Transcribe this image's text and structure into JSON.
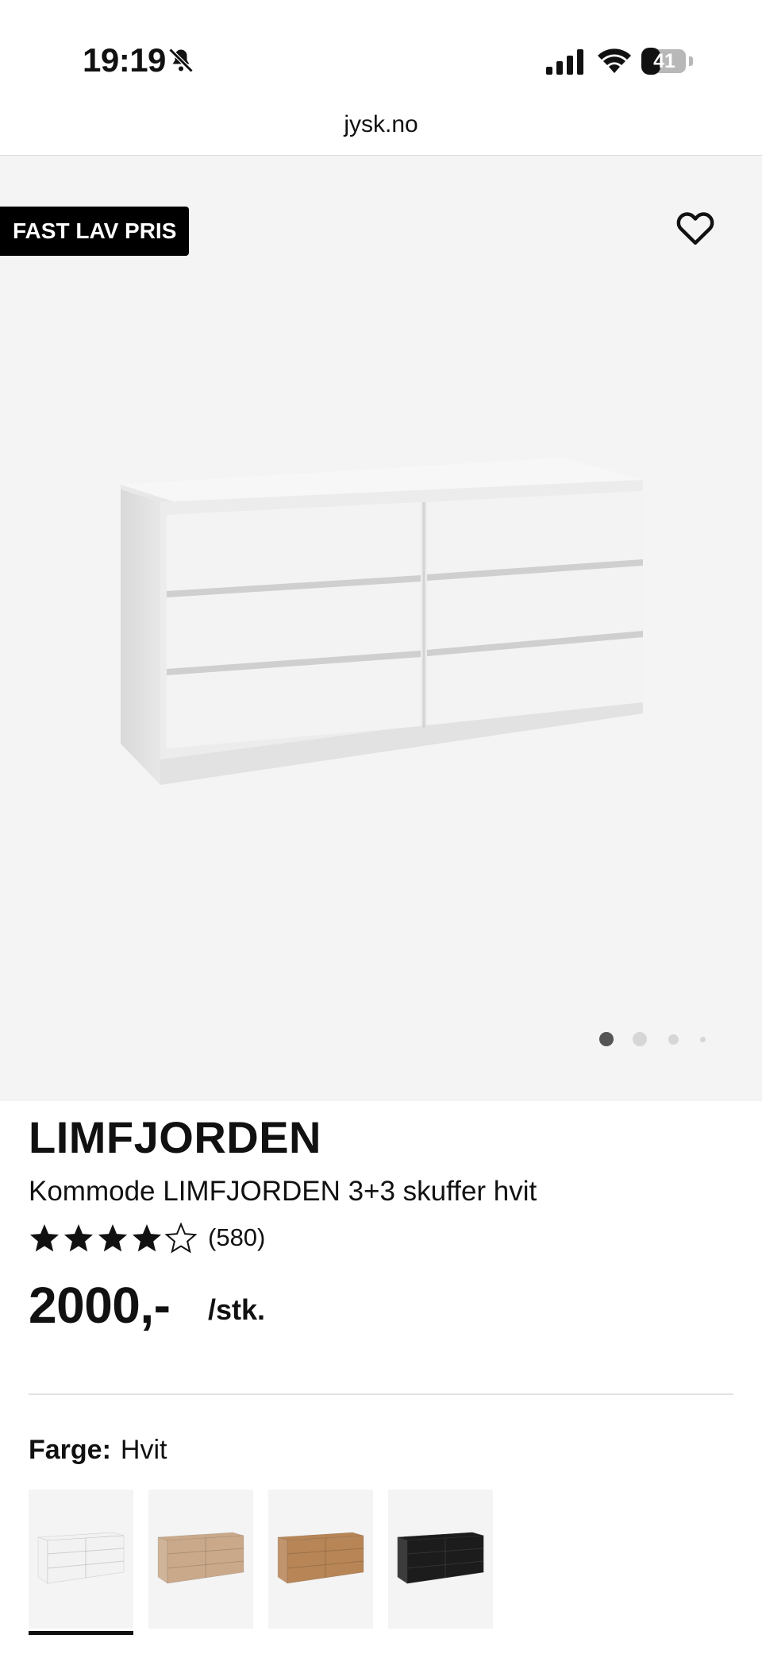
{
  "status_bar": {
    "time": "19:19",
    "battery_level": "41",
    "icons": [
      "bell-muted-icon",
      "cellular-signal-icon",
      "wifi-icon",
      "battery-icon"
    ]
  },
  "browser": {
    "url": "jysk.no"
  },
  "gallery": {
    "badge": "FAST LAV PRIS",
    "image_count": 4,
    "active_image": 1,
    "icons": [
      "heart-icon"
    ]
  },
  "product": {
    "name": "LIMFJORDEN",
    "description": "Kommode LIMFJORDEN 3+3 skuffer hvit",
    "rating": 4,
    "rating_max": 5,
    "review_count": "(580)",
    "price": "2000,-",
    "unit": "/stk."
  },
  "color_selector": {
    "label": "Farge:",
    "value": "Hvit",
    "swatches": [
      {
        "color": "#f2f2f2",
        "selected": true
      },
      {
        "color": "#c9a98a",
        "selected": false
      },
      {
        "color": "#b78556",
        "selected": false
      },
      {
        "color": "#1c1c1c",
        "selected": false
      }
    ]
  }
}
